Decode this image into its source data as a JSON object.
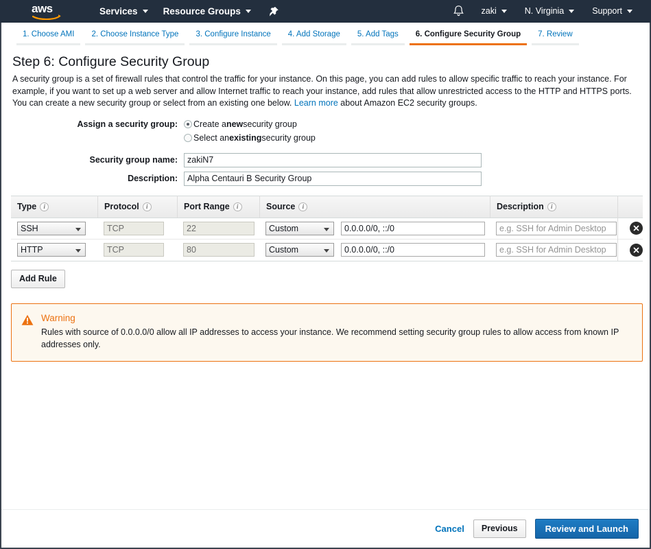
{
  "navbar": {
    "logo_text": "aws",
    "items": [
      {
        "label": "Services",
        "icon": "chevron-down-icon"
      },
      {
        "label": "Resource Groups",
        "icon": "chevron-down-icon"
      }
    ],
    "pin_icon": "pin-icon",
    "bell_icon": "bell-icon",
    "right_items": [
      {
        "label": "zaki"
      },
      {
        "label": "N. Virginia"
      },
      {
        "label": "Support"
      }
    ]
  },
  "steps": [
    {
      "label": "1. Choose AMI",
      "active": false
    },
    {
      "label": "2. Choose Instance Type",
      "active": false
    },
    {
      "label": "3. Configure Instance",
      "active": false
    },
    {
      "label": "4. Add Storage",
      "active": false
    },
    {
      "label": "5. Add Tags",
      "active": false
    },
    {
      "label": "6. Configure Security Group",
      "active": true
    },
    {
      "label": "7. Review",
      "active": false
    }
  ],
  "page": {
    "title": "Step 6: Configure Security Group",
    "desc_part1": "A security group is a set of firewall rules that control the traffic for your instance. On this page, you can add rules to allow specific traffic to reach your instance. For example, if you want to set up a web server and allow Internet traffic to reach your instance, add rules that allow unrestricted access to the HTTP and HTTPS ports. You can create a new security group or select from an existing one below. ",
    "learn_more": "Learn more",
    "desc_part2": " about Amazon EC2 security groups."
  },
  "form": {
    "assign_label": "Assign a security group:",
    "radio_new": {
      "pre": "Create a ",
      "strong": "new",
      "post": " security group",
      "checked": true
    },
    "radio_existing": {
      "pre": "Select an ",
      "strong": "existing",
      "post": " security group",
      "checked": false
    },
    "name_label": "Security group name:",
    "name_value": "zakiN7",
    "description_label": "Description:",
    "description_value": "Alpha Centauri B Security Group"
  },
  "table": {
    "headers": [
      {
        "label": "Type",
        "info": "info-icon"
      },
      {
        "label": "Protocol",
        "info": "info-icon"
      },
      {
        "label": "Port Range",
        "info": "info-icon"
      },
      {
        "label": "Source",
        "info": "info-icon"
      },
      {
        "label": "Description",
        "info": "info-icon"
      }
    ],
    "desc_placeholder": "e.g. SSH for Admin Desktop",
    "rows": [
      {
        "type": "SSH",
        "protocol": "TCP",
        "port": "22",
        "source_type": "Custom",
        "source": "0.0.0.0/0, ::/0",
        "description": ""
      },
      {
        "type": "HTTP",
        "protocol": "TCP",
        "port": "80",
        "source_type": "Custom",
        "source": "0.0.0.0/0, ::/0",
        "description": ""
      }
    ],
    "add_rule_label": "Add Rule"
  },
  "warning": {
    "icon": "warning-triangle-icon",
    "title": "Warning",
    "text": "Rules with source of 0.0.0.0/0 allow all IP addresses to access your instance. We recommend setting security group rules to allow access from known IP addresses only."
  },
  "footer": {
    "cancel": "Cancel",
    "previous": "Previous",
    "review_launch": "Review and Launch"
  },
  "colors": {
    "nav_bg": "#232f3e",
    "accent_orange": "#ec7211",
    "link_blue": "#0073bb",
    "primary_blue": "#1565a8",
    "warning_bg": "#fdf8ef"
  }
}
